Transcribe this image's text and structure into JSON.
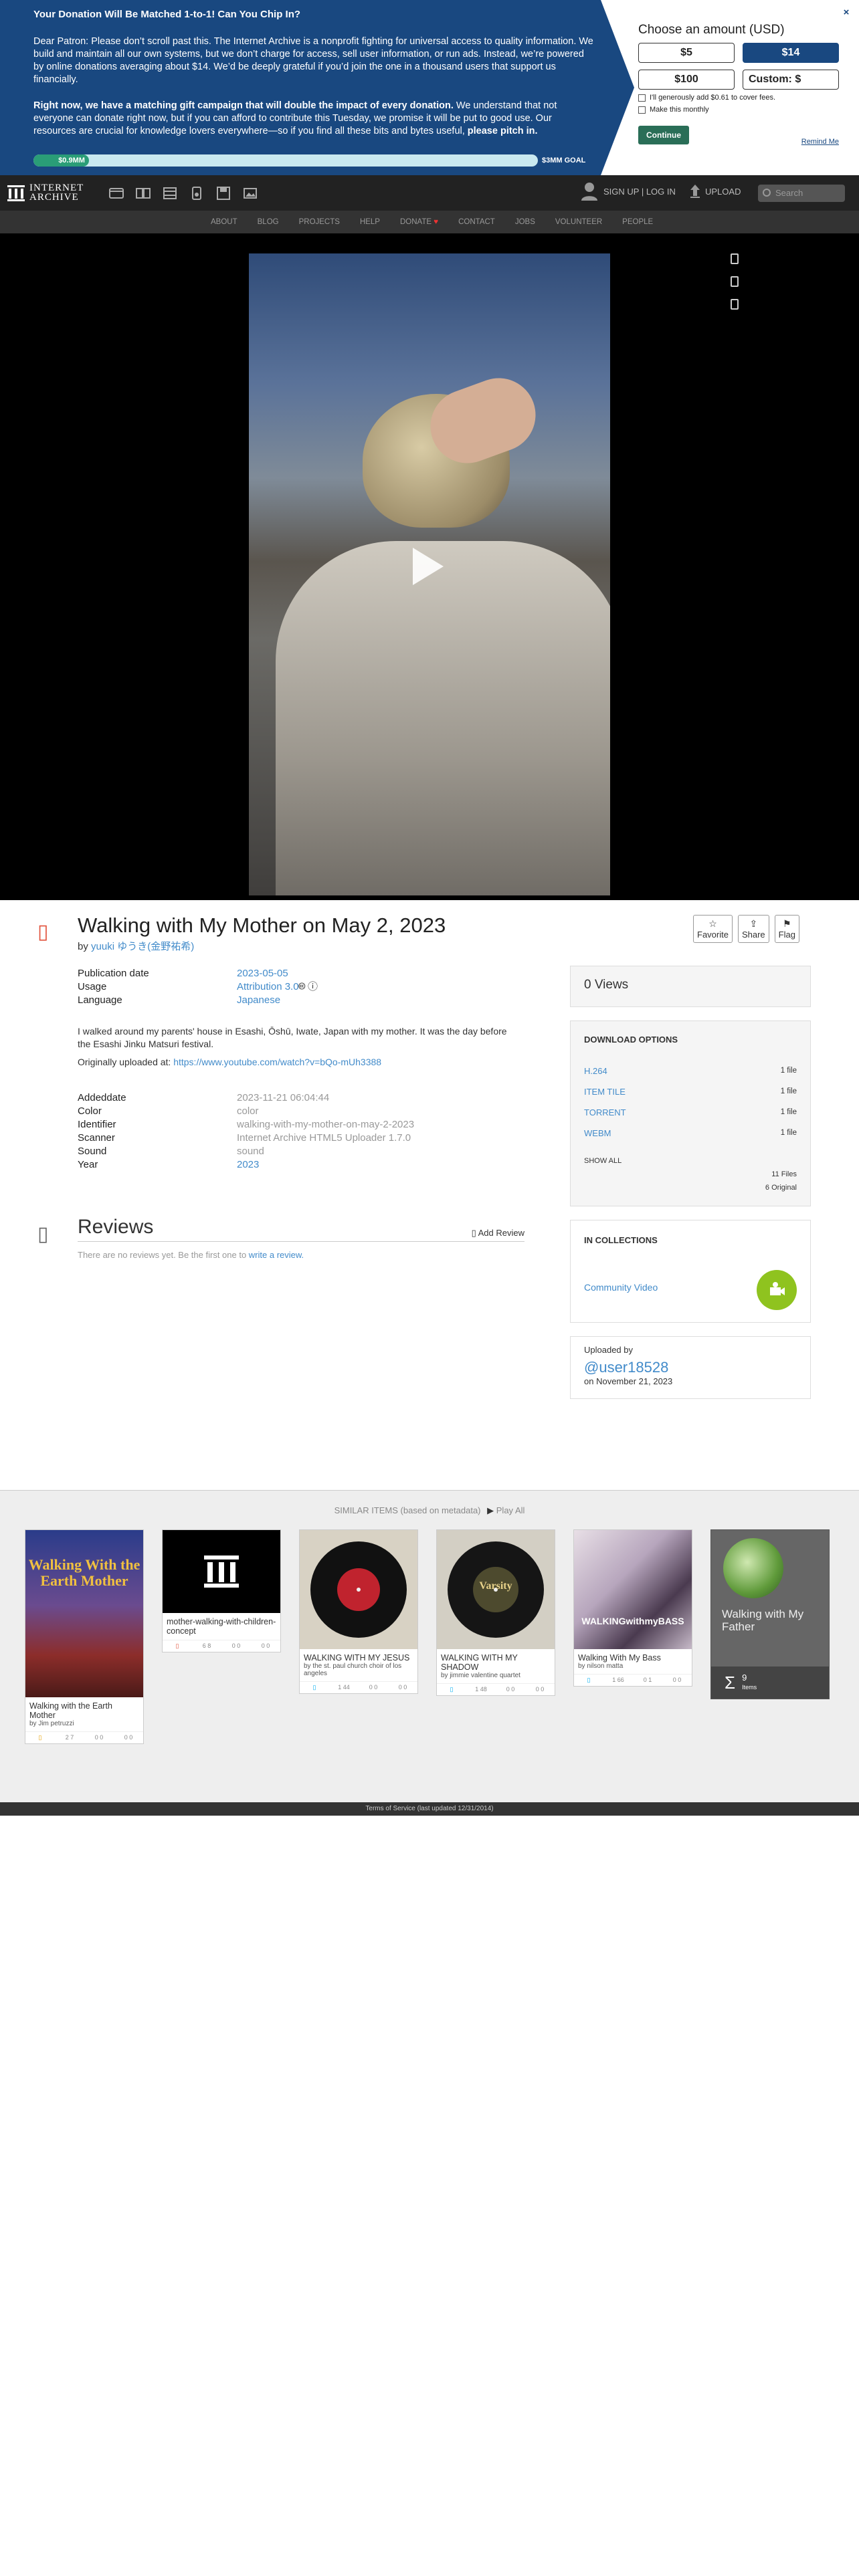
{
  "donation": {
    "headline": "Your Donation Will Be Matched 1-to-1! Can You Chip In?",
    "para1": "Dear Patron: Please don’t scroll past this. The Internet Archive is a nonprofit fighting for universal access to quality information. We build and maintain all our own systems, but we don’t charge for access, sell user information, or run ads. Instead, we’re powered by online donations averaging about $14. We’d be deeply grateful if you’d join the one in a thousand users that support us financially.",
    "para2_bold": "Right now, we have a matching gift campaign that will double the impact of every donation.",
    "para2_rest": " We understand that not everyone can donate right now, but if you can afford to contribute this Tuesday, we promise it will be put to good use. Our resources are crucial for knowledge lovers everywhere—so if you find all these bits and bytes useful, ",
    "para2_end": "please pitch in.",
    "progress_label": "$0.9MM",
    "progress_fraction": 0.11,
    "goal_label": "$3MM GOAL",
    "choose_title": "Choose an amount (USD)",
    "amounts": [
      "$5",
      "$14",
      "$100",
      "Custom: $"
    ],
    "selected_amount": "$14",
    "cover_fees": "I'll generously add $0.61 to cover fees.",
    "monthly": "Make this monthly",
    "continue": "Continue",
    "remind": "Remind Me",
    "close": "×"
  },
  "topnav": {
    "logo_line1": "INTERNET",
    "logo_line2": "ARCHIVE",
    "signup": "SIGN UP | LOG IN",
    "upload": "UPLOAD",
    "search_placeholder": "Search"
  },
  "subnav": [
    "ABOUT",
    "BLOG",
    "PROJECTS",
    "HELP",
    "DONATE",
    "CONTACT",
    "JOBS",
    "VOLUNTEER",
    "PEOPLE"
  ],
  "item": {
    "title": "Walking with My Mother on May 2, 2023",
    "by_prefix": "by",
    "author": "yuuki ゆうき(金野祐希)",
    "actions": [
      "Favorite",
      "Share",
      "Flag"
    ],
    "meta1": [
      {
        "k": "Publication date",
        "v": "2023-05-05"
      },
      {
        "k": "Usage",
        "v": "Attribution 3.0"
      },
      {
        "k": "Language",
        "v": "Japanese"
      }
    ],
    "description": "I walked around my parents' house in Esashi, Ōshū, Iwate, Japan with my mother. It was the day before the Esashi Jinku Matsuri festival.",
    "orig_label": "Originally uploaded at: ",
    "orig_url": "https://www.youtube.com/watch?v=bQo-mUh3388",
    "meta2": [
      {
        "k": "Addeddate",
        "v": "2023-11-21 06:04:44"
      },
      {
        "k": "Color",
        "v": "color"
      },
      {
        "k": "Identifier",
        "v": "walking-with-my-mother-on-may-2-2023"
      },
      {
        "k": "Scanner",
        "v": "Internet Archive HTML5 Uploader 1.7.0"
      },
      {
        "k": "Sound",
        "v": "sound"
      },
      {
        "k": "Year",
        "v": "2023"
      }
    ],
    "reviews_title": "Reviews",
    "add_review": "Add Review",
    "no_reviews": "There are no reviews yet. Be the first one to ",
    "write_review": "write a review."
  },
  "sidebar": {
    "views": "0 Views",
    "download_title": "DOWNLOAD OPTIONS",
    "downloads": [
      {
        "label": "H.264",
        "count": "1 file"
      },
      {
        "label": "ITEM TILE",
        "count": "1 file"
      },
      {
        "label": "TORRENT",
        "count": "1 file"
      },
      {
        "label": "WEBM",
        "count": "1 file"
      }
    ],
    "show_all": "SHOW ALL",
    "files": "11 Files",
    "original": "6 Original",
    "collections_title": "IN COLLECTIONS",
    "collection": "Community Video",
    "uploaded_by": "Uploaded by",
    "uploader": "@user18528",
    "uploaded_on": "on November 21, 2023"
  },
  "similar": {
    "heading": "SIMILAR ITEMS (based on metadata)",
    "play_all": "Play All",
    "tiles": [
      {
        "title": "Walking with the Earth Mother",
        "by": "by Jim petruzzi",
        "stats": [
          "",
          "2 7",
          "0 0",
          "0 0"
        ]
      },
      {
        "title": "mother-walking-with-children-concept",
        "by": "",
        "stats": [
          "",
          "6 8",
          "0 0",
          "0 0"
        ]
      },
      {
        "title": "WALKING WITH MY JESUS",
        "by": "by the st. paul church choir of los angeles",
        "stats": [
          "",
          "1 44",
          "0 0",
          "0 0"
        ]
      },
      {
        "title": "WALKING WITH MY SHADOW",
        "by": "by jimmie valentine quartet",
        "stats": [
          "",
          "1 48",
          "0 0",
          "0 0"
        ]
      },
      {
        "title": "Walking With My Bass",
        "by": "by nilson matta",
        "stats": [
          "",
          "1 66",
          "0 1",
          "0 0"
        ]
      },
      {
        "title": "Walking with My Father",
        "count": "9",
        "count_label": "Items"
      }
    ],
    "tile_banner_text": "Walking With the Earth Mother",
    "bass_text": "WALKINGwithmyBASS",
    "varsity_text": "Varsity"
  },
  "footer": "Terms of Service (last updated 12/31/2014)"
}
